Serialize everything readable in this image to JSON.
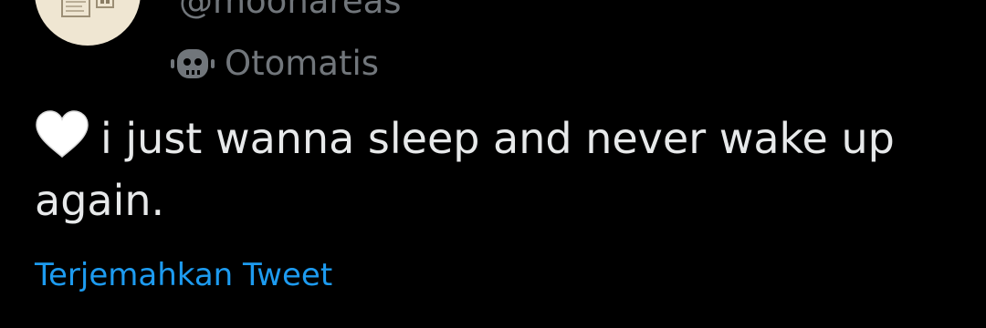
{
  "tweet": {
    "handle": "@moonareas",
    "automated_label": "Otomatis",
    "text": "i just wanna sleep and never wake up again.",
    "emoji_icon": "white-heart-icon",
    "translate_label": "Terjemahkan Tweet"
  },
  "colors": {
    "background": "#000000",
    "text_primary": "#e7e9ea",
    "text_secondary": "#71767b",
    "link": "#1d9bf0",
    "avatar_bg": "#efe6d2"
  }
}
